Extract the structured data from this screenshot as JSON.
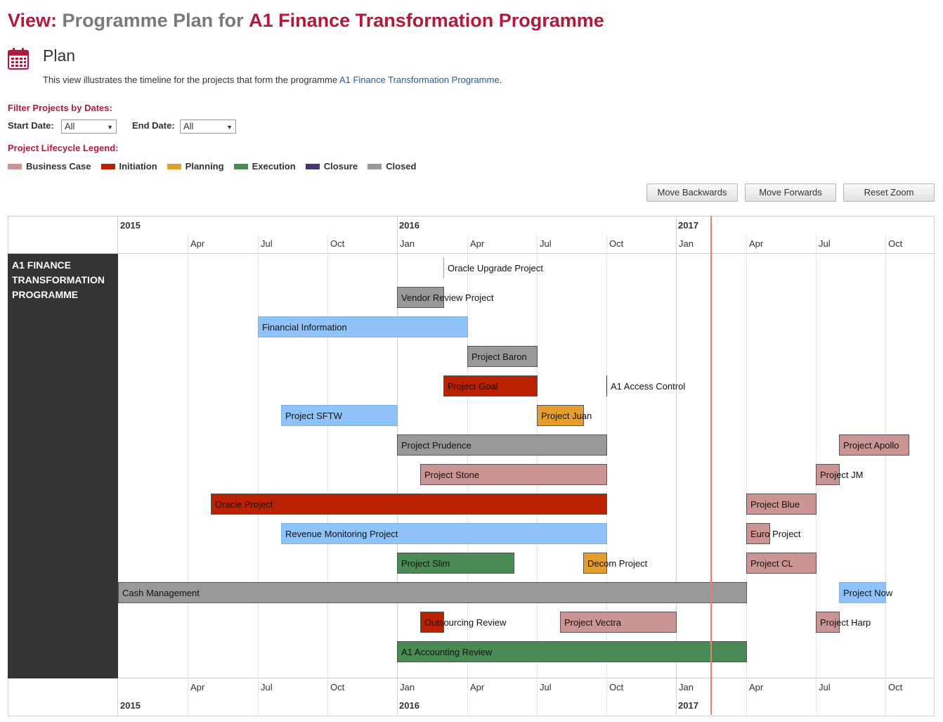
{
  "header": {
    "view_label": "View:",
    "title_middle": "Programme Plan for",
    "programme_name": "A1 Finance Transformation Programme"
  },
  "plan": {
    "icon": "calendar-icon",
    "title": "Plan",
    "intro_text": "This view illustrates the timeline for the projects that form the programme",
    "intro_link": "A1 Finance Transformation Programme",
    "intro_end": "."
  },
  "filter": {
    "heading": "Filter Projects by Dates:",
    "start_label": "Start Date:",
    "start_value": "All",
    "end_label": "End Date:",
    "end_value": "All"
  },
  "legend": {
    "heading": "Project Lifecycle Legend:",
    "items": [
      {
        "label": "Business Case",
        "color": "#cc9595"
      },
      {
        "label": "Initiation",
        "color": "#b82200"
      },
      {
        "label": "Planning",
        "color": "#e59e2e"
      },
      {
        "label": "Execution",
        "color": "#4a8a55"
      },
      {
        "label": "Closure",
        "color": "#4b3575"
      },
      {
        "label": "Closed",
        "color": "#999999"
      }
    ]
  },
  "buttons": {
    "backwards": "Move Backwards",
    "forwards": "Move Forwards",
    "reset": "Reset Zoom"
  },
  "timeline": {
    "group_label": "A1 FINANCE TRANSFORMATION PROGRAMME",
    "years": [
      "2015",
      "2016",
      "2017"
    ],
    "months": [
      "Apr",
      "Jul",
      "Oct",
      "Jan",
      "Apr",
      "Jul",
      "Oct",
      "Jan",
      "Apr",
      "Jul",
      "Oct"
    ],
    "today": "2017-02-15",
    "projects": [
      {
        "name": "Oracle Upgrade Project",
        "start": "2016-03-01",
        "end": "2016-03-01",
        "status": "Execution-light",
        "color": "#6fa8e0",
        "milestone": true,
        "row": 0
      },
      {
        "name": "Vendor Review Project",
        "start": "2016-01-01",
        "end": "2016-03-01",
        "status": "Closed",
        "color": "#999999",
        "row": 1
      },
      {
        "name": "Financial Information",
        "start": "2015-07-01",
        "end": "2016-04-01",
        "color": "#90c4f8",
        "row": 2
      },
      {
        "name": "Project Baron",
        "start": "2016-04-01",
        "end": "2016-07-01",
        "color": "#999999",
        "row": 3
      },
      {
        "name": "Project Goal",
        "start": "2016-03-01",
        "end": "2016-07-01",
        "color": "#b82200",
        "row": 4
      },
      {
        "name": "A1 Access Control",
        "start": "2016-10-01",
        "end": "2016-10-01",
        "color": "#333333",
        "milestone": true,
        "row": 4
      },
      {
        "name": "Project SFTW",
        "start": "2015-08-01",
        "end": "2016-01-01",
        "color": "#90c4f8",
        "row": 5
      },
      {
        "name": "Project Juan",
        "start": "2016-07-01",
        "end": "2016-09-01",
        "color": "#e59e2e",
        "row": 5
      },
      {
        "name": "Project Prudence",
        "start": "2016-01-01",
        "end": "2016-10-01",
        "color": "#999999",
        "row": 6
      },
      {
        "name": "Project Apollo",
        "start": "2017-08-01",
        "end": "2017-11-01",
        "color": "#cc9595",
        "row": 6
      },
      {
        "name": "Project Stone",
        "start": "2016-02-01",
        "end": "2016-10-01",
        "color": "#cc9595",
        "row": 7
      },
      {
        "name": "Project JM",
        "start": "2017-07-01",
        "end": "2017-08-01",
        "color": "#cc9595",
        "row": 7
      },
      {
        "name": "Oracle Project",
        "start": "2015-05-01",
        "end": "2016-10-01",
        "color": "#b82200",
        "row": 8
      },
      {
        "name": "Project Blue",
        "start": "2017-04-01",
        "end": "2017-07-01",
        "color": "#cc9595",
        "row": 8
      },
      {
        "name": "Revenue Monitoring Project",
        "start": "2015-08-01",
        "end": "2016-10-01",
        "color": "#90c4f8",
        "row": 9
      },
      {
        "name": "Euro Project",
        "start": "2017-04-01",
        "end": "2017-05-01",
        "color": "#cc9595",
        "row": 9
      },
      {
        "name": "Project Slim",
        "start": "2016-01-01",
        "end": "2016-06-01",
        "color": "#4a8a55",
        "row": 10
      },
      {
        "name": "Decom Project",
        "start": "2016-09-01",
        "end": "2016-10-01",
        "color": "#e59e2e",
        "row": 10
      },
      {
        "name": "Project CL",
        "start": "2017-04-01",
        "end": "2017-07-01",
        "color": "#cc9595",
        "row": 10
      },
      {
        "name": "Cash Management",
        "start": "2015-01-01",
        "end": "2017-04-01",
        "color": "#999999",
        "row": 11
      },
      {
        "name": "Project Now",
        "start": "2017-08-01",
        "end": "2017-10-01",
        "color": "#90c4f8",
        "row": 11
      },
      {
        "name": "Outsourcing Review",
        "start": "2016-02-01",
        "end": "2016-03-01",
        "color": "#b82200",
        "row": 12
      },
      {
        "name": "Project Vectra",
        "start": "2016-08-01",
        "end": "2017-01-01",
        "color": "#cc9595",
        "row": 12
      },
      {
        "name": "Project Harp",
        "start": "2017-07-01",
        "end": "2017-08-01",
        "color": "#cc9595",
        "row": 12
      },
      {
        "name": "A1 Accounting Review",
        "start": "2016-01-01",
        "end": "2017-04-01",
        "color": "#4a8a55",
        "row": 13
      }
    ]
  }
}
